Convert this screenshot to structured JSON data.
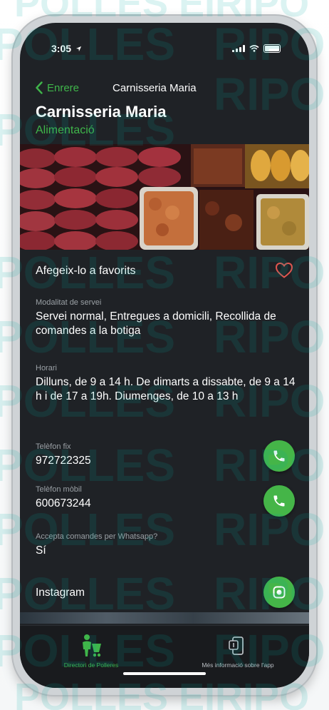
{
  "watermark": {
    "text_left": "POLLES",
    "text_right": "RIPO",
    "top_text": "POLLES EIRIPO"
  },
  "status_bar": {
    "time": "3:05"
  },
  "nav": {
    "back_label": "Enrere",
    "title": "Carnisseria Maria"
  },
  "store": {
    "name": "Carnisseria Maria",
    "category": "Alimentació"
  },
  "favorite": {
    "label": "Afegeix-lo a favorits"
  },
  "details": {
    "service_mode": {
      "label": "Modalitat de servei",
      "value": "Servei normal, Entregues a domicili, Recollida de comandes a la botiga"
    },
    "hours": {
      "label": "Horari",
      "value": "Dilluns, de 9 a 14 h. De dimarts a dissabte, de 9 a 14 h i de 17 a 19h. Diumenges, de 10 a 13 h"
    },
    "landline": {
      "label": "Telèfon fix",
      "value": "972722325"
    },
    "mobile": {
      "label": "Telèfon mòbil",
      "value": "600673244"
    },
    "whatsapp": {
      "label": "Accepta comandes per Whatsapp?",
      "value": "Sí"
    },
    "instagram": {
      "label": "Instagram"
    }
  },
  "tabbar": {
    "tab_directory": "Directori de Polleres",
    "tab_info": "Més informació sobre l'app"
  },
  "colors": {
    "accent_green": "#3fb54a",
    "screen_bg": "#1f2226",
    "heart": "#e0564f"
  }
}
